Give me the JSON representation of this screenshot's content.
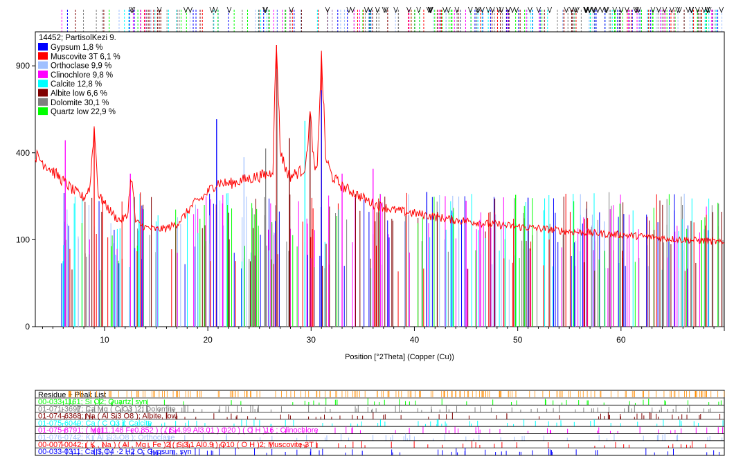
{
  "chart_data": {
    "type": "line",
    "title": "",
    "xlabel": "Position [°2Theta] (Copper (Cu))",
    "ylabel": "",
    "xlim": [
      3.3,
      70
    ],
    "ylim": [
      0,
      1150
    ],
    "y_scale": "sqrt",
    "x_ticks": [
      10,
      20,
      30,
      40,
      50,
      60
    ],
    "y_ticks": [
      0,
      100,
      400,
      900
    ],
    "grid": false,
    "legend": {
      "placement": "top-left",
      "header": "14452; PartisolKezi 9.",
      "entries": [
        {
          "label": "Gypsum 1,8 %",
          "color": "#0000ff"
        },
        {
          "label": "Muscovite 3T 6,1 %",
          "color": "#ff0000"
        },
        {
          "label": "Orthoclase 9,9 %",
          "color": "#a0c0ff"
        },
        {
          "label": "Clinochlore 9,8 %",
          "color": "#ff00ff"
        },
        {
          "label": "Calcite 12,8 %",
          "color": "#00ffff"
        },
        {
          "label": "Albite low 6,6 %",
          "color": "#800000"
        },
        {
          "label": "Dolomite 30,1 %",
          "color": "#808080"
        },
        {
          "label": "Quartz low 22,9 %",
          "color": "#00ff00"
        }
      ]
    },
    "series": [
      {
        "color": "#ff0000",
        "x": [
          3.3,
          4,
          5,
          6,
          7,
          8,
          8.6,
          9.0,
          9.4,
          10,
          11,
          11.5,
          12.2,
          12.6,
          13,
          14,
          15,
          16,
          17,
          17.8,
          18.5,
          19,
          19.5,
          20,
          20.5,
          21,
          22,
          23,
          24,
          25,
          26,
          26.3,
          26.65,
          27,
          27.5,
          28,
          28.5,
          29,
          29.5,
          29.9,
          30.3,
          30.6,
          31.0,
          31.4,
          32,
          33,
          34,
          35,
          36,
          37,
          38,
          39,
          40,
          41,
          42,
          43,
          44,
          45,
          46,
          47,
          48,
          49,
          50,
          51,
          52,
          53,
          54,
          55,
          56,
          57,
          58,
          59,
          60,
          61,
          62,
          63,
          64,
          65,
          66,
          67,
          68,
          69,
          70
        ],
        "y": [
          390,
          360,
          320,
          280,
          245,
          220,
          260,
          520,
          230,
          200,
          160,
          150,
          160,
          300,
          145,
          130,
          125,
          128,
          140,
          165,
          195,
          210,
          220,
          240,
          260,
          275,
          270,
          280,
          290,
          300,
          310,
          330,
          1050,
          420,
          330,
          300,
          310,
          320,
          340,
          600,
          330,
          320,
          950,
          380,
          300,
          260,
          240,
          220,
          200,
          190,
          180,
          175,
          170,
          165,
          160,
          155,
          150,
          148,
          145,
          140,
          138,
          135,
          132,
          130,
          128,
          125,
          123,
          120,
          118,
          116,
          115,
          113,
          112,
          110,
          108,
          106,
          104,
          102,
          100,
          99,
          98,
          96,
          92
        ]
      }
    ],
    "peaks": [
      {
        "x": 26.65,
        "y": 1050,
        "color": "#ff0000"
      },
      {
        "x": 31.0,
        "y": 950,
        "color": "#ff0000"
      },
      {
        "x": 26.7,
        "y": 880,
        "color": "#808080"
      },
      {
        "x": 31.0,
        "y": 740,
        "color": "#0000ff"
      },
      {
        "x": 29.4,
        "y": 560,
        "color": "#00ffff"
      },
      {
        "x": 29.9,
        "y": 600,
        "color": "#800000"
      },
      {
        "x": 20.85,
        "y": 570,
        "color": "#0000ff"
      },
      {
        "x": 9.0,
        "y": 520,
        "color": "#ff0000"
      },
      {
        "x": 6.2,
        "y": 460,
        "color": "#ff00ff"
      },
      {
        "x": 12.5,
        "y": 310,
        "color": "#ff00ff"
      },
      {
        "x": 23.5,
        "y": 380,
        "color": "#a0c0ff"
      },
      {
        "x": 25.6,
        "y": 420,
        "color": "#808080"
      },
      {
        "x": 27.9,
        "y": 470,
        "color": "#800000"
      },
      {
        "x": 33.0,
        "y": 310,
        "color": "#ff00ff"
      },
      {
        "x": 36.0,
        "y": 330,
        "color": "#ff00ff"
      },
      {
        "x": 41.2,
        "y": 240,
        "color": "#0000ff"
      },
      {
        "x": 45.0,
        "y": 210,
        "color": "#ff00ff"
      },
      {
        "x": 49.8,
        "y": 230,
        "color": "#00ff00"
      },
      {
        "x": 51.0,
        "y": 220,
        "color": "#0000ff"
      },
      {
        "x": 59.9,
        "y": 200,
        "color": "#00ff00"
      },
      {
        "x": 67.8,
        "y": 150,
        "color": "#00ff00"
      }
    ]
  },
  "reference_strip": {
    "header": "Residue + Peak List",
    "rows": [
      {
        "label": "00-033-1161; Si O2; Quartz, syn",
        "color": "#00ff00"
      },
      {
        "label": "01-071-3697; Ca Mg ( C O3 )2; Dolomite",
        "color": "#808080"
      },
      {
        "label": "01-074-6368; Na ( Al Si3 O8 ); Albite, low",
        "color": "#800000"
      },
      {
        "label": "01-075-6049; Ca ( C O3 ); Calcite",
        "color": "#00ffff"
      },
      {
        "label": "01-075-8791; ( Mg11.148 Fe0.852 ) ( ( Si4.99 Al3.01 ) O20 ) ( O H )16 ; Clinochlore",
        "color": "#ff00ff"
      },
      {
        "label": "01-076-0742; K ( Al Si3 O8 ); Orthoclase",
        "color": "#a0c0ff"
      },
      {
        "label": "00-007-0042; ( K , Na ) ( Al , Mg , Fe )2 ( Si3.1 Al0.9 ) O10 ( O H )2; Muscovite-3T",
        "color": "#ff0000"
      },
      {
        "label": "00-033-0311; Ca S O4 ·2 H2 O; Gypsum, syn",
        "color": "#0000ff"
      }
    ]
  }
}
